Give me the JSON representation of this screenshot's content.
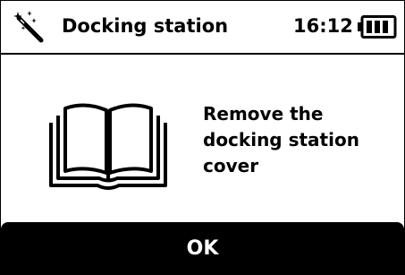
{
  "header": {
    "icon": "magic-wand-icon",
    "title": "Docking station",
    "time": "16:12",
    "battery_icon": "battery-full-icon"
  },
  "content": {
    "icon": "manual-book-icon",
    "message_lines": [
      "Remove the",
      "docking station",
      "cover"
    ]
  },
  "actions": {
    "ok_label": "OK"
  },
  "colors": {
    "foreground": "#000000",
    "background": "#ffffff",
    "button_background": "#000000",
    "button_text": "#ffffff"
  }
}
